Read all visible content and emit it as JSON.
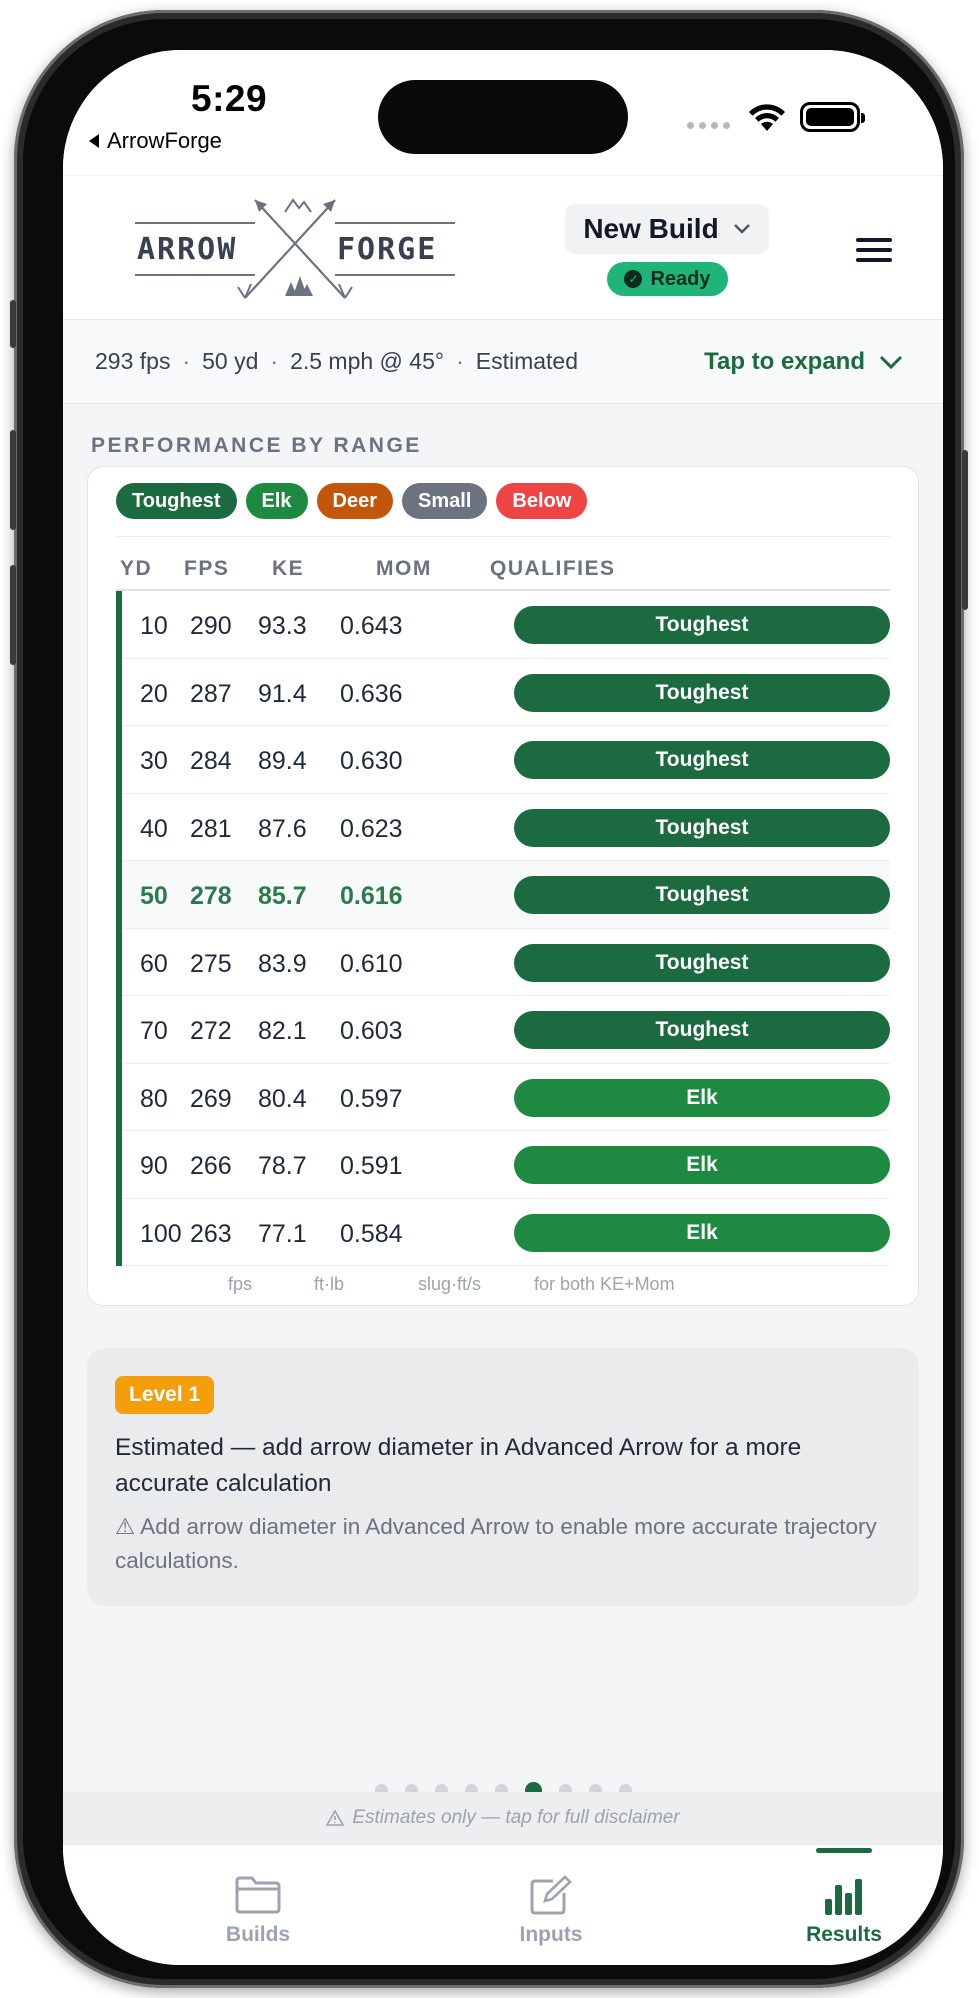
{
  "status_bar": {
    "time": "5:29",
    "back_app": "ArrowForge"
  },
  "header": {
    "logo_left": "ARROW",
    "logo_right": "FORGE",
    "build_name": "New Build",
    "status_badge": "Ready",
    "menu_icon": "hamburger-menu-icon"
  },
  "summary": {
    "items": [
      "293 fps",
      "50 yd",
      "2.5 mph @ 45°",
      "Estimated"
    ],
    "separator": "·",
    "expand_label": "Tap to expand"
  },
  "performance": {
    "section_title": "PERFORMANCE BY RANGE",
    "legend": [
      {
        "label": "Toughest",
        "color": "#1c6b40"
      },
      {
        "label": "Elk",
        "color": "#1e8a41"
      },
      {
        "label": "Deer",
        "color": "#c2570c"
      },
      {
        "label": "Small",
        "color": "#6b7280"
      },
      {
        "label": "Below",
        "color": "#ef4444"
      }
    ],
    "columns": [
      "YD",
      "FPS",
      "KE",
      "MOM",
      "QUALIFIES"
    ],
    "rows": [
      {
        "yd": "10",
        "fps": "290",
        "ke": "93.3",
        "mom": "0.643",
        "qualifies": "Toughest",
        "highlight": false
      },
      {
        "yd": "20",
        "fps": "287",
        "ke": "91.4",
        "mom": "0.636",
        "qualifies": "Toughest",
        "highlight": false
      },
      {
        "yd": "30",
        "fps": "284",
        "ke": "89.4",
        "mom": "0.630",
        "qualifies": "Toughest",
        "highlight": false
      },
      {
        "yd": "40",
        "fps": "281",
        "ke": "87.6",
        "mom": "0.623",
        "qualifies": "Toughest",
        "highlight": false
      },
      {
        "yd": "50",
        "fps": "278",
        "ke": "85.7",
        "mom": "0.616",
        "qualifies": "Toughest",
        "highlight": true
      },
      {
        "yd": "60",
        "fps": "275",
        "ke": "83.9",
        "mom": "0.610",
        "qualifies": "Toughest",
        "highlight": false
      },
      {
        "yd": "70",
        "fps": "272",
        "ke": "82.1",
        "mom": "0.603",
        "qualifies": "Toughest",
        "highlight": false
      },
      {
        "yd": "80",
        "fps": "269",
        "ke": "80.4",
        "mom": "0.597",
        "qualifies": "Elk",
        "highlight": false
      },
      {
        "yd": "90",
        "fps": "266",
        "ke": "78.7",
        "mom": "0.591",
        "qualifies": "Elk",
        "highlight": false
      },
      {
        "yd": "100",
        "fps": "263",
        "ke": "77.1",
        "mom": "0.584",
        "qualifies": "Elk",
        "highlight": false
      }
    ],
    "units": {
      "fps": "fps",
      "ke": "ft·lb",
      "mom": "slug·ft/s",
      "qualifies": "for both KE+Mom"
    }
  },
  "info": {
    "level_badge": "Level 1",
    "main_text": "Estimated — add arrow diameter in Advanced Arrow for a more accurate calculation",
    "sub_text": "⚠ Add arrow diameter in Advanced Arrow to enable more accurate trajectory calculations."
  },
  "pager": {
    "count": 9,
    "active_index": 5
  },
  "disclaimer": "Estimates only — tap for full disclaimer",
  "tabs": [
    {
      "label": "Builds",
      "icon": "folder-icon",
      "active": false
    },
    {
      "label": "Inputs",
      "icon": "edit-icon",
      "active": false
    },
    {
      "label": "Results",
      "icon": "bar-chart-icon",
      "active": true
    }
  ],
  "colors": {
    "brand_green": "#1c6b40",
    "elk_green": "#1e8a41",
    "ready_green": "#1fb57a",
    "level_amber": "#f59e0b"
  }
}
